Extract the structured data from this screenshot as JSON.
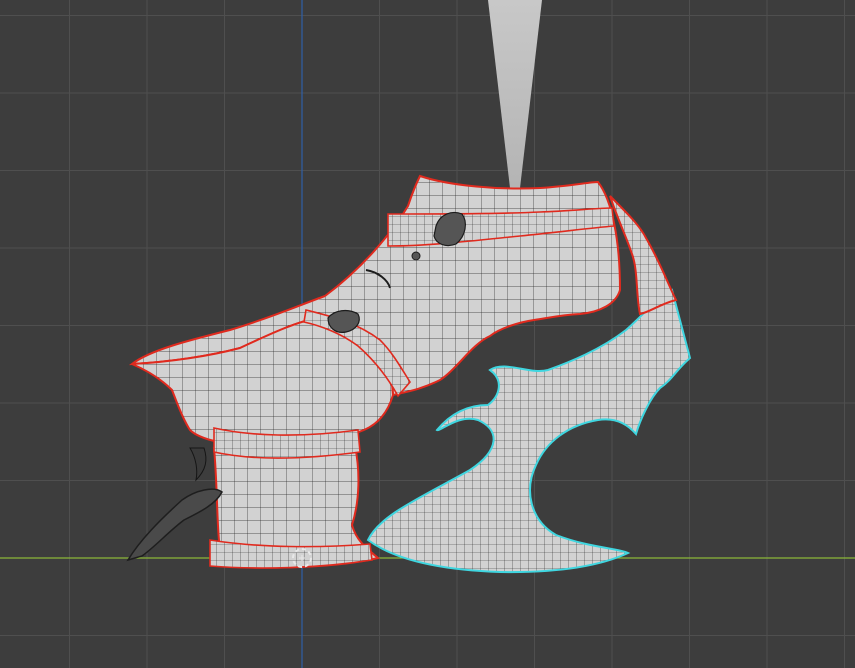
{
  "viewport": {
    "background_color": "#3d3d3d",
    "grid_minor_color": "#464646",
    "grid_major_color": "#4f4f4f",
    "x_axis_color": "#8bb73a",
    "z_axis_color": "#2f5fa6"
  },
  "model": {
    "surface_color": "#d2d2d2",
    "shade_color": "#a8a8a8",
    "wire_color": "#2a2a2a",
    "seam_color": "#e02a1e",
    "selected_edge_color": "#3fd6e0",
    "buckle_color": "#555555"
  },
  "light": {
    "beam_color": "#cfcfcf"
  },
  "cursor": {
    "ring_color": "#e8e8e8",
    "accent_color": "#d83a2a",
    "icon": "3d-cursor-icon"
  }
}
